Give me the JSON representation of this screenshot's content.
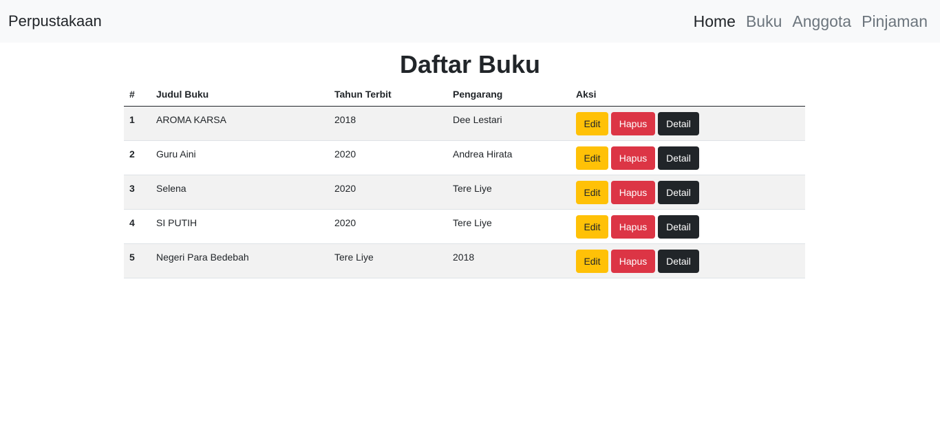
{
  "navbar": {
    "brand": "Perpustakaan",
    "links": [
      {
        "label": "Home",
        "active": true
      },
      {
        "label": "Buku",
        "active": false
      },
      {
        "label": "Anggota",
        "active": false
      },
      {
        "label": "Pinjaman",
        "active": false
      }
    ]
  },
  "page": {
    "title": "Daftar Buku"
  },
  "table": {
    "headers": [
      "#",
      "Judul Buku",
      "Tahun Terbit",
      "Pengarang",
      "Aksi"
    ],
    "rows": [
      {
        "no": "1",
        "judul": "AROMA KARSA",
        "tahun": "2018",
        "pengarang": "Dee Lestari"
      },
      {
        "no": "2",
        "judul": "Guru Aini",
        "tahun": "2020",
        "pengarang": "Andrea Hirata"
      },
      {
        "no": "3",
        "judul": "Selena",
        "tahun": "2020",
        "pengarang": "Tere Liye"
      },
      {
        "no": "4",
        "judul": "SI PUTIH",
        "tahun": "2020",
        "pengarang": "Tere Liye"
      },
      {
        "no": "5",
        "judul": "Negeri Para Bedebah",
        "tahun": "Tere Liye",
        "pengarang": "2018"
      }
    ],
    "actions": {
      "edit": "Edit",
      "hapus": "Hapus",
      "detail": "Detail"
    }
  },
  "colors": {
    "navbar_bg": "#f8f9fa",
    "edit": "#ffc107",
    "hapus": "#dc3545",
    "detail": "#212529",
    "stripe": "#f2f2f2"
  }
}
